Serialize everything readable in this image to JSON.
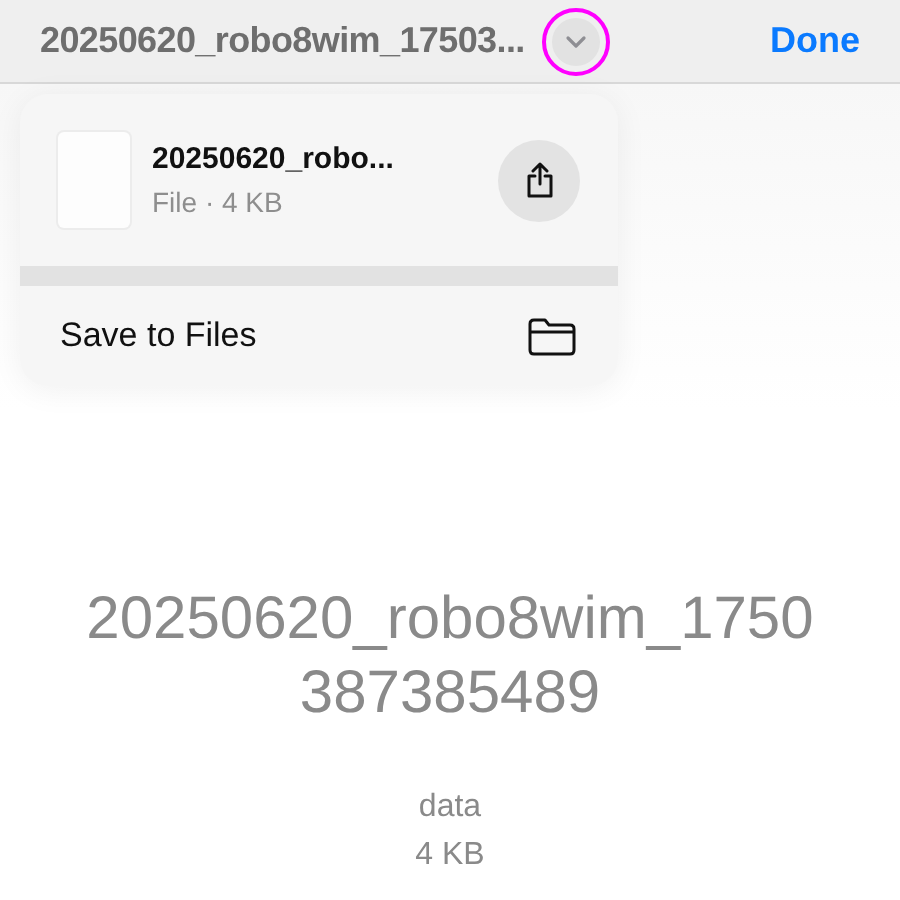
{
  "header": {
    "title": "20250620_robo8wim_17503...",
    "menu_button": {
      "highlighted": true
    },
    "done": "Done"
  },
  "menu": {
    "file": {
      "name": "20250620_robo...",
      "details": "File · 4 KB"
    },
    "actions": [
      {
        "label": "Save to Files"
      }
    ]
  },
  "preview": {
    "name": "20250620_robo8wim_1750387385489",
    "type": "data",
    "size": "4 KB"
  }
}
